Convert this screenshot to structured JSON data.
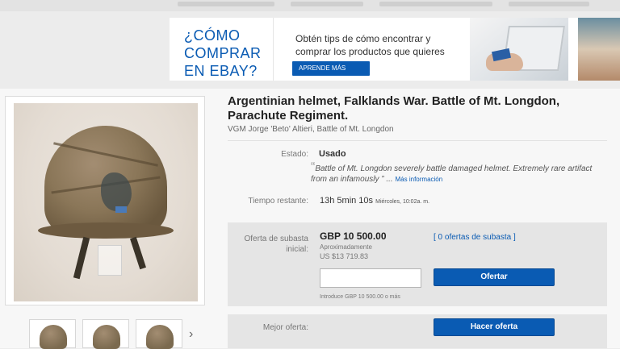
{
  "banner": {
    "headline": [
      "¿CÓMO",
      "COMPRAR",
      "EN EBAY?"
    ],
    "tip_lines": [
      "Obtén tips de cómo encontrar y",
      "comprar los  productos que quieres"
    ],
    "learn_more": "APRENDE MÁS"
  },
  "listing": {
    "title_lines": [
      "Argentinian helmet, Falklands War. Battle of Mt. Longdon,",
      "Parachute Regiment."
    ],
    "subtitle": "VGM Jorge 'Beto' Altieri, Battle of Mt. Longdon",
    "condition_label": "Estado:",
    "condition_value": "Usado",
    "quote_mark": "“",
    "quote_text": "Battle of Mt. Longdon severely battle damaged helmet. Extremely rare artifact from an infamously",
    "quote_close": "” ...",
    "more_info": "Más información",
    "time_label": "Tiempo restante:",
    "time_value": "13h 5min 10s",
    "time_detail": "Miércoles, 10:02a. m.",
    "bid_label": "Oferta de subasta inicial:",
    "price": "GBP 10 500.00",
    "approx_label": "Aproximadamente",
    "approx_value": "US $13 719.83",
    "bids_link": "[ 0 ofertas de subasta ]",
    "bid_input_value": "",
    "bid_button": "Ofertar",
    "bid_hint": "Introduce GBP 10 500.00 o más",
    "best_offer_label": "Mejor oferta:",
    "best_offer_button": "Hacer oferta"
  },
  "gallery": {
    "next_arrow": "›"
  }
}
